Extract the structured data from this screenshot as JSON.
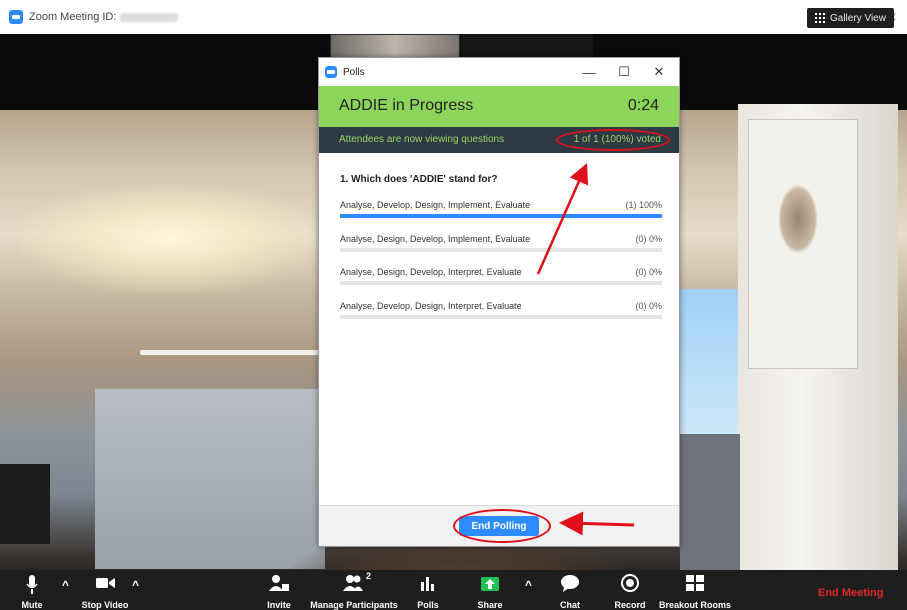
{
  "window": {
    "title_prefix": "Zoom Meeting ID:",
    "minimize": "—",
    "maximize": "☐",
    "close": "✕"
  },
  "header": {
    "gallery_view_label": "Gallery View",
    "fullscreen_glyph": "⛶"
  },
  "polls_window": {
    "title": "Polls",
    "minimize": "—",
    "maximize": "☐",
    "close": "✕",
    "poll_name": "ADDIE  in Progress",
    "timer": "0:24",
    "status_message": "Attendees are now viewing questions",
    "voted_summary": "1 of 1 (100%) voted",
    "question": "1. Which does 'ADDIE' stand for?",
    "answers": [
      {
        "text": "Analyse, Develop, Design, Implement, Evaluate",
        "result": "(1) 100%",
        "fraction": 1.0
      },
      {
        "text": "Analyse, Design, Develop, Implement, Evaluate",
        "result": "(0) 0%",
        "fraction": 0.0
      },
      {
        "text": "Analyse, Design, Develop, Interpret, Evaluate",
        "result": "(0) 0%",
        "fraction": 0.0
      },
      {
        "text": "Analyse, Develop, Design, Interpret, Evaluate",
        "result": "(0) 0%",
        "fraction": 0.0
      }
    ],
    "end_polling_label": "End Polling",
    "accent_color": "#8cd45a",
    "button_color": "#2d8cff",
    "annotation_color": "#e0101a"
  },
  "toolbar": {
    "mute_label": "Mute",
    "stop_video_label": "Stop Video",
    "invite_label": "Invite",
    "manage_participants_label": "Manage Participants",
    "participant_count": "2",
    "polls_label": "Polls",
    "share_label": "Share",
    "chat_label": "Chat",
    "record_label": "Record",
    "breakout_rooms_label": "Breakout Rooms",
    "end_meeting_label": "End Meeting",
    "caret": "^"
  }
}
